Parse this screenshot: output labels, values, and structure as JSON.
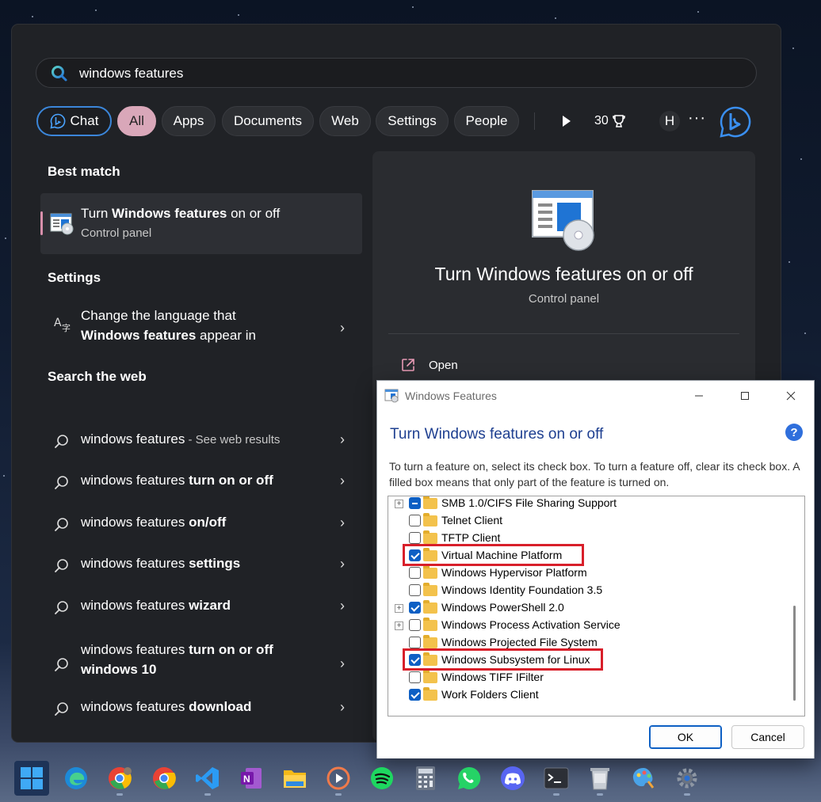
{
  "search": {
    "query": "windows features"
  },
  "filters": [
    {
      "label": "Chat",
      "name": "filter-chat"
    },
    {
      "label": "All",
      "name": "filter-all"
    },
    {
      "label": "Apps",
      "name": "filter-apps"
    },
    {
      "label": "Documents",
      "name": "filter-documents"
    },
    {
      "label": "Web",
      "name": "filter-web"
    },
    {
      "label": "Settings",
      "name": "filter-settings"
    },
    {
      "label": "People",
      "name": "filter-people"
    }
  ],
  "toolbar": {
    "points": "30",
    "avatar_letter": "H",
    "more": "···"
  },
  "sections": {
    "best_match": "Best match",
    "settings": "Settings",
    "search_web": "Search the web"
  },
  "best_match": {
    "title_pre": "Turn ",
    "title_bold": "Windows features",
    "title_post": " on or off",
    "subtitle": "Control panel"
  },
  "settings_item": {
    "line1": "Change the language that",
    "line2_bold": "Windows features",
    "line2_post": " appear in"
  },
  "web_results": [
    {
      "plain": "windows features",
      "bold": "",
      "suffix": " - See web results"
    },
    {
      "plain": "windows features ",
      "bold": "turn on or off",
      "suffix": ""
    },
    {
      "plain": "windows features ",
      "bold": "on/off",
      "suffix": ""
    },
    {
      "plain": "windows features ",
      "bold": "settings",
      "suffix": ""
    },
    {
      "plain": "windows features ",
      "bold": "wizard",
      "suffix": ""
    },
    {
      "plain": "windows features ",
      "bold": "turn on or off",
      "line2": "windows 10",
      "suffix": ""
    },
    {
      "plain": "windows features ",
      "bold": "download",
      "suffix": ""
    }
  ],
  "preview": {
    "title": "Turn Windows features on or off",
    "subtitle": "Control panel",
    "open_label": "Open"
  },
  "dialog": {
    "title": "Windows Features",
    "heading": "Turn Windows features on or off",
    "help": "?",
    "description": "To turn a feature on, select its check box. To turn a feature off, clear its check box. A filled box means that only part of the feature is turned on.",
    "features": [
      {
        "label": "SMB 1.0/CIFS File Sharing Support",
        "state": "partial",
        "expandable": true
      },
      {
        "label": "Telnet Client",
        "state": "off",
        "expandable": false
      },
      {
        "label": "TFTP Client",
        "state": "off",
        "expandable": false
      },
      {
        "label": "Virtual Machine Platform",
        "state": "on",
        "expandable": false,
        "highlighted": true
      },
      {
        "label": "Windows Hypervisor Platform",
        "state": "off",
        "expandable": false
      },
      {
        "label": "Windows Identity Foundation 3.5",
        "state": "off",
        "expandable": false
      },
      {
        "label": "Windows PowerShell 2.0",
        "state": "on",
        "expandable": true
      },
      {
        "label": "Windows Process Activation Service",
        "state": "off",
        "expandable": true
      },
      {
        "label": "Windows Projected File System",
        "state": "off",
        "expandable": false
      },
      {
        "label": "Windows Subsystem for Linux",
        "state": "on",
        "expandable": false,
        "highlighted": true
      },
      {
        "label": "Windows TIFF IFilter",
        "state": "off",
        "expandable": false
      },
      {
        "label": "Work Folders Client",
        "state": "on",
        "expandable": false
      }
    ],
    "ok_label": "OK",
    "cancel_label": "Cancel"
  },
  "taskbar": [
    {
      "name": "start-button",
      "icon": "windows-logo-icon"
    },
    {
      "name": "taskbar-edge",
      "icon": "edge-icon"
    },
    {
      "name": "taskbar-chrome-profile",
      "icon": "chrome-icon"
    },
    {
      "name": "taskbar-chrome",
      "icon": "chrome-icon"
    },
    {
      "name": "taskbar-vscode",
      "icon": "vscode-icon"
    },
    {
      "name": "taskbar-onenote",
      "icon": "onenote-icon"
    },
    {
      "name": "taskbar-file-explorer",
      "icon": "folder-icon"
    },
    {
      "name": "taskbar-media-player",
      "icon": "play-icon"
    },
    {
      "name": "taskbar-spotify",
      "icon": "spotify-icon"
    },
    {
      "name": "taskbar-calculator",
      "icon": "calculator-icon"
    },
    {
      "name": "taskbar-whatsapp",
      "icon": "whatsapp-icon"
    },
    {
      "name": "taskbar-discord",
      "icon": "discord-icon"
    },
    {
      "name": "taskbar-terminal",
      "icon": "terminal-icon"
    },
    {
      "name": "taskbar-recycle",
      "icon": "recycle-bin-icon"
    },
    {
      "name": "taskbar-paint",
      "icon": "paint-icon"
    },
    {
      "name": "taskbar-settings",
      "icon": "gear-icon"
    }
  ],
  "colors": {
    "accent_blue": "#3b86d9",
    "all_chip": "#d9a7b9",
    "dialog_heading": "#1e3f90",
    "highlight_red": "#d81f2a",
    "checkbox_blue": "#0d5fc4"
  }
}
